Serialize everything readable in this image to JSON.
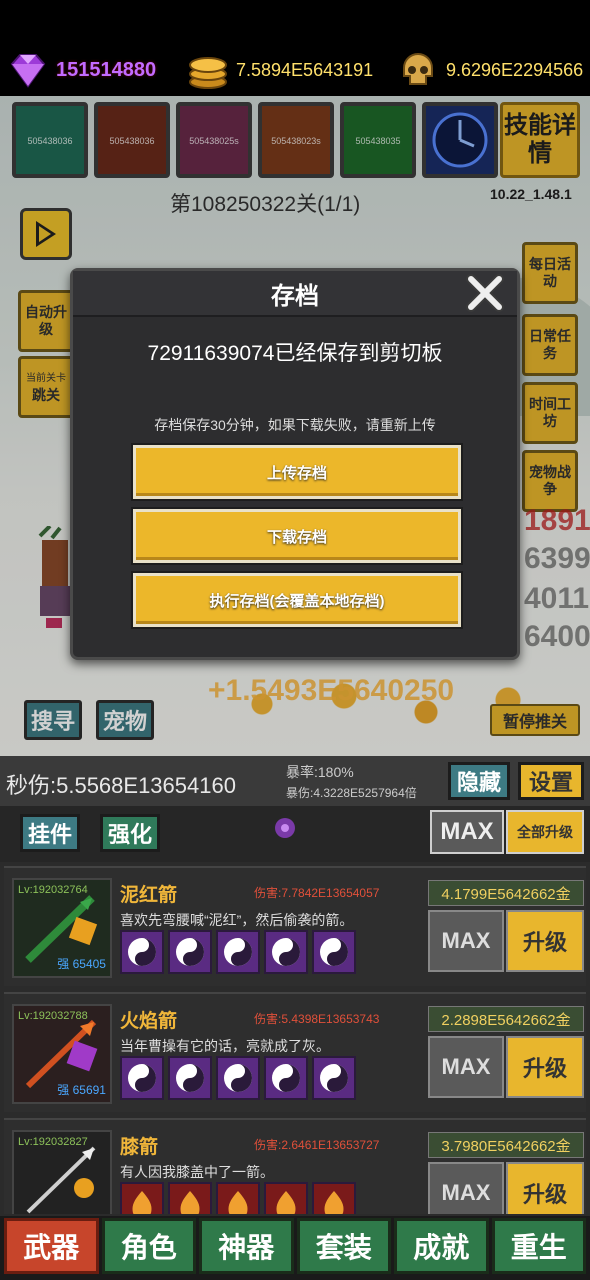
{
  "currency": {
    "gems": "151514880",
    "coins": "7.5894E5643191",
    "skulls": "9.6296E2294566"
  },
  "skills": [
    {
      "cooldown": "505438036",
      "color": "#1f6a55"
    },
    {
      "cooldown": "505438036",
      "color": "#6a2a1a"
    },
    {
      "cooldown": "505438025s",
      "color": "#6a2a4a"
    },
    {
      "cooldown": "505438023s",
      "color": "#7a3a1a"
    },
    {
      "cooldown": "505438035",
      "color": "#1e6a2a"
    },
    {
      "cooldown": "",
      "color": "#1a2e6a"
    }
  ],
  "skill_detail_label": "技能详情",
  "stage": "第108250322关(1/1)",
  "version": "10.22_1.48.1",
  "left_buttons": [
    "自动升级",
    "跳关"
  ],
  "skip_small": "当前关卡",
  "right_buttons": [
    "每日活动",
    "日常任务",
    "时间工坊",
    "宠物战争"
  ],
  "floating_damage": "+1.5493E5640250",
  "right_damage": [
    "1891",
    "6399",
    "4011",
    "6400"
  ],
  "search_label": "搜寻",
  "pet_label": "宠物",
  "pause_label": "暂停推关",
  "modal": {
    "title": "存档",
    "saved_message": "72911639074已经保存到剪切板",
    "hint": "存档保存30分钟，如果下载失败，请重新上传",
    "upload": "上传存档",
    "download": "下载存档",
    "execute": "执行存档(会覆盖本地存档)"
  },
  "panel": {
    "dps": "秒伤:5.5568E13654160",
    "crit_rate": "暴率:180%",
    "crit_dmg": "暴伤:4.3228E5257964倍",
    "hide": "隐藏",
    "settings": "设置",
    "tab_hang": "挂件",
    "tab_enhance": "强化",
    "max_all": "MAX",
    "upgrade_all": "全部升级"
  },
  "weapons": [
    {
      "lv": "Lv:192032764",
      "strength": "强 65405",
      "name": "泥红箭",
      "damage": "伤害:7.7842E13654057",
      "desc": "喜欢先弯腰喊“泥红”，然后偷袭的箭。",
      "cost": "4.1799E5642662金",
      "max": "MAX",
      "upgrade": "升级",
      "gem": "purple"
    },
    {
      "lv": "Lv:192032788",
      "strength": "强 65691",
      "name": "火焰箭",
      "damage": "伤害:5.4398E13653743",
      "desc": "当年曹操有它的话，亮就成了灰。",
      "cost": "2.2898E5642662金",
      "max": "MAX",
      "upgrade": "升级",
      "gem": "purple"
    },
    {
      "lv": "Lv:192032827",
      "strength": "",
      "name": "膝箭",
      "damage": "伤害:2.6461E13653727",
      "desc": "有人因我膝盖中了一箭。",
      "cost": "3.7980E5642662金",
      "max": "MAX",
      "upgrade": "升级",
      "gem": "red"
    }
  ],
  "nav": [
    "武器",
    "角色",
    "神器",
    "套装",
    "成就",
    "重生"
  ]
}
